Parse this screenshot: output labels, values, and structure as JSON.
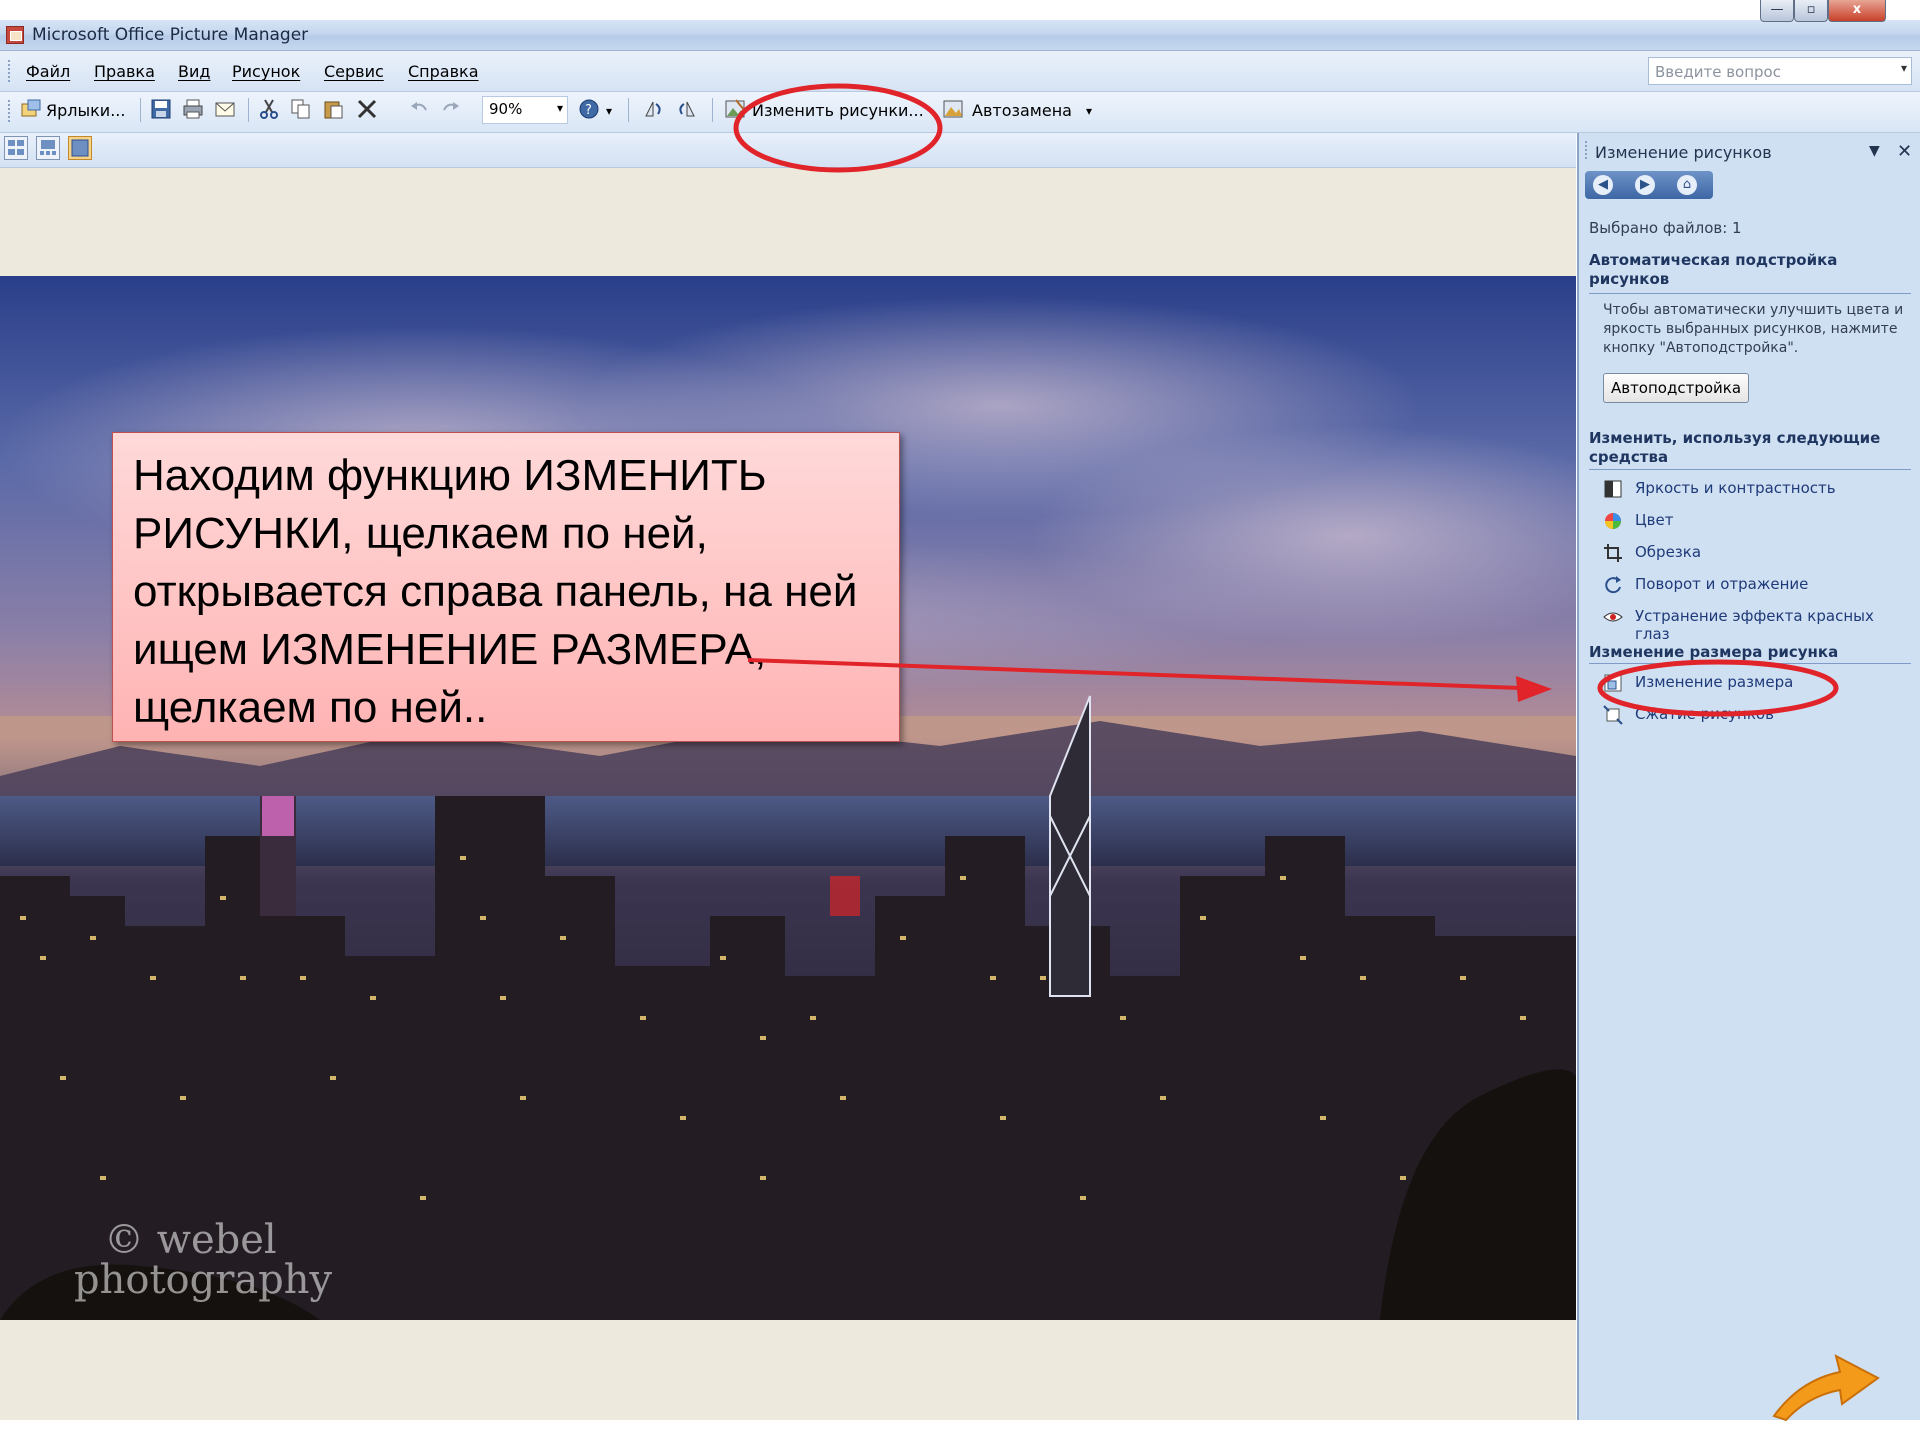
{
  "window": {
    "title": "Microsoft Office Picture Manager",
    "min_glyph": "—",
    "max_glyph": "▫",
    "close_glyph": "x"
  },
  "menu": {
    "items": [
      "Файл",
      "Правка",
      "Вид",
      "Рисунок",
      "Сервис",
      "Справка"
    ],
    "ask_placeholder": "Введите вопрос"
  },
  "toolbar": {
    "shortcuts_label": "Ярлыки...",
    "zoom_value": "90%",
    "edit_pictures_label": "Изменить рисунки...",
    "autocorrect_label": "Автозамена"
  },
  "photo": {
    "watermark_line1": "© webel",
    "watermark_line2": "photography"
  },
  "callout": {
    "text": "Находим функцию ИЗМЕНИТЬ РИСУНКИ, щелкаем по ней, открывается справа панель, на ней ищем ИЗМЕНЕНИЕ РАЗМЕРА, щелкаем по ней.."
  },
  "task_pane": {
    "title": "Изменение рисунков",
    "selected_files": "Выбрано файлов: 1",
    "auto_section_title": "Автоматическая подстройка рисунков",
    "auto_section_desc": "Чтобы автоматически улучшить цвета и яркость выбранных рисунков, нажмите кнопку \"Автоподстройка\".",
    "autofix_button": "Автоподстройка",
    "edit_tools_title": "Изменить, используя следующие средства",
    "edit_tools": [
      "Яркость и контрастность",
      "Цвет",
      "Обрезка",
      "Поворот и отражение",
      "Устранение эффекта красных глаз"
    ],
    "resize_section_title": "Изменение размера рисунка",
    "resize_links": [
      "Изменение размера",
      "Сжатие рисунков"
    ]
  },
  "colors": {
    "annotation_red": "#e0242a",
    "task_pane_bg": "#cfe0f3",
    "callout_fill": "#ffc4c4",
    "next_arrow": "#f39a1b"
  },
  "icons": [
    "app-icon",
    "shortcuts-icon",
    "save-icon",
    "print-icon",
    "email-icon",
    "cut-icon",
    "copy-icon",
    "paste-icon",
    "delete-icon",
    "undo-icon",
    "redo-icon",
    "help-icon",
    "rotate-left-icon",
    "rotate-right-icon",
    "edit-pictures-icon",
    "autocorrect-icon",
    "thumbnail-view-icon",
    "filmstrip-view-icon",
    "single-view-icon",
    "back-icon",
    "forward-icon",
    "home-icon",
    "brightness-icon",
    "color-icon",
    "crop-icon",
    "rotate-flip-icon",
    "red-eye-icon",
    "resize-icon",
    "compress-icon",
    "next-slide-arrow-icon"
  ]
}
